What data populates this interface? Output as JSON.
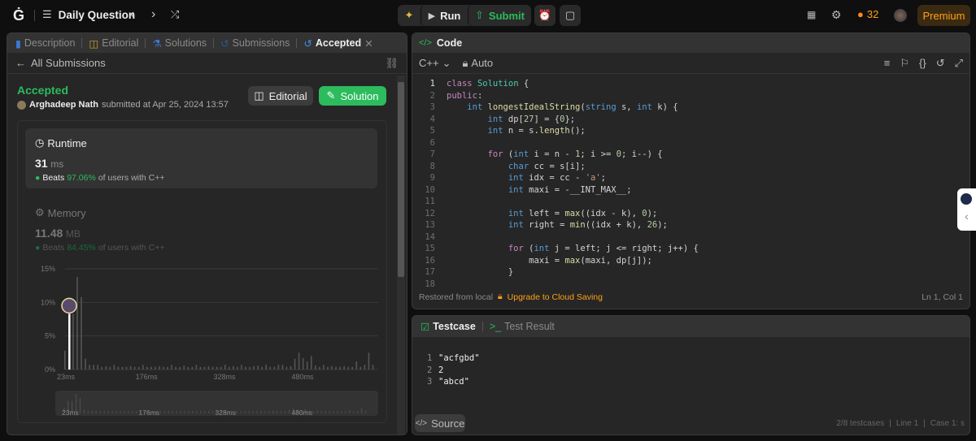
{
  "topbar": {
    "title": "Daily Question",
    "run_label": "Run",
    "submit_label": "Submit",
    "streak": "32",
    "premium_label": "Premium"
  },
  "left": {
    "tabs": [
      {
        "label": "Description",
        "icon": "description-icon"
      },
      {
        "label": "Editorial",
        "icon": "book-icon"
      },
      {
        "label": "Solutions",
        "icon": "flask-icon"
      },
      {
        "label": "Submissions",
        "icon": "history-icon"
      },
      {
        "label": "Accepted",
        "icon": "history-icon",
        "active": true
      }
    ],
    "back_label": "All Submissions",
    "status": "Accepted",
    "user": "Arghadeep Nath",
    "submitted_text": "submitted at Apr 25, 2024 13:57",
    "editorial_btn": "Editorial",
    "solution_btn": "Solution",
    "runtime": {
      "label": "Runtime",
      "value": "31",
      "unit": "ms",
      "beats_prefix": "Beats",
      "beats": "97.06%",
      "beats_suffix": "of users with C++"
    },
    "memory": {
      "label": "Memory",
      "value": "11.48",
      "unit": "MB",
      "beats_prefix": "Beats",
      "beats": "84.45%",
      "beats_suffix": "of users with C++"
    }
  },
  "chart_data": {
    "type": "bar",
    "xlabel": "",
    "ylabel": "",
    "y_ticks": [
      "0%",
      "5%",
      "10%",
      "15%"
    ],
    "ylim": [
      0,
      15
    ],
    "x_ticks": [
      "23ms",
      "176ms",
      "328ms",
      "480ms"
    ],
    "x_tick_values": [
      23,
      176,
      328,
      480
    ],
    "xlim": [
      23,
      633
    ],
    "grid": true,
    "highlight_x": 31,
    "x": [
      23,
      31,
      39,
      47,
      55,
      63,
      71,
      79,
      87,
      95,
      103,
      111,
      119,
      127,
      135,
      143,
      151,
      159,
      167,
      175,
      183,
      191,
      199,
      207,
      215,
      223,
      231,
      239,
      247,
      255,
      263,
      271,
      279,
      287,
      295,
      303,
      311,
      319,
      327,
      335,
      343,
      351,
      359,
      367,
      375,
      383,
      391,
      399,
      407,
      415,
      423,
      431,
      439,
      447,
      455,
      463,
      471,
      479,
      487,
      495,
      503,
      511,
      519,
      527,
      535,
      543,
      551,
      559,
      567,
      575,
      583,
      591,
      599,
      607,
      615,
      623
    ],
    "values": [
      2.8,
      8.3,
      8.3,
      13.8,
      10.8,
      1.6,
      0.7,
      0.7,
      0.7,
      0.4,
      0.5,
      0.4,
      0.7,
      0.4,
      0.4,
      0.4,
      0.5,
      0.4,
      0.4,
      0.7,
      0.4,
      0.4,
      0.4,
      0.5,
      0.4,
      0.4,
      0.7,
      0.4,
      0.4,
      0.6,
      0.4,
      0.4,
      0.7,
      0.4,
      0.4,
      0.5,
      0.4,
      0.4,
      0.4,
      0.7,
      0.4,
      0.5,
      0.4,
      0.7,
      0.4,
      0.4,
      0.5,
      0.6,
      0.4,
      0.7,
      0.4,
      0.4,
      0.7,
      0.7,
      0.4,
      0.5,
      1.6,
      2.5,
      1.7,
      1.2,
      2.0,
      0.6,
      0.4,
      0.7,
      0.4,
      0.5,
      0.4,
      0.4,
      0.5,
      0.4,
      0.4,
      1.2,
      0.4,
      0.7,
      2.5,
      0.7
    ]
  },
  "code": {
    "title": "Code",
    "language": "C++",
    "mode": "Auto",
    "lines": [
      "class Solution {",
      "public:",
      "    int longestIdealString(string s, int k) {",
      "        int dp[27] = {0};",
      "        int n = s.length();",
      "",
      "        for (int i = n - 1; i >= 0; i--) {",
      "            char cc = s[i];",
      "            int idx = cc - 'a';",
      "            int maxi = -__INT_MAX__;",
      "",
      "            int left = max((idx - k), 0);",
      "            int right = min((idx + k), 26);",
      "",
      "            for (int j = left; j <= right; j++) {",
      "                maxi = max(maxi, dp[j]);",
      "            }",
      ""
    ],
    "restored": "Restored from local",
    "upgrade": "Upgrade to Cloud Saving",
    "cursor": "Ln 1, Col 1"
  },
  "testcase": {
    "tab": "Testcase",
    "result_tab": "Test Result",
    "lines": [
      "\"acfgbd\"",
      "2",
      "\"abcd\""
    ],
    "source_label": "Source",
    "count": "2/8 testcases",
    "line": "Line 1",
    "case": "Case 1: s"
  },
  "colors": {
    "accent_green": "#2cbb5d",
    "premium": "#ffa116",
    "bg": "#0f0f0f",
    "panel": "#262626"
  }
}
